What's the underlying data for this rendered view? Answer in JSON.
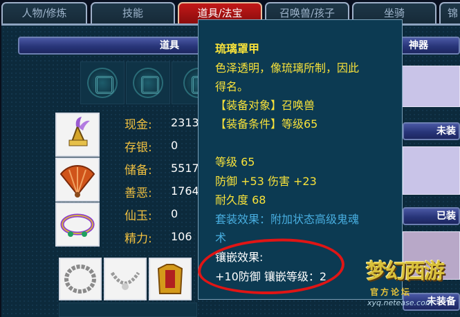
{
  "tabs": [
    {
      "label": "人物/修炼",
      "active": false
    },
    {
      "label": "技能",
      "active": false
    },
    {
      "label": "道具/法宝",
      "active": true
    },
    {
      "label": "召唤兽/孩子",
      "active": false
    },
    {
      "label": "坐骑",
      "active": false
    },
    {
      "label": "锦",
      "active": false
    }
  ],
  "panel": {
    "items_header": "道具",
    "shenqi_header": "神器",
    "side_labels": [
      "未装",
      "已装",
      "未装备"
    ]
  },
  "stats": [
    {
      "label": "现金:",
      "value": "2313"
    },
    {
      "label": "存银:",
      "value": "0"
    },
    {
      "label": "储备:",
      "value": "5517"
    },
    {
      "label": "善恶:",
      "value": "1764"
    },
    {
      "label": "仙玉:",
      "value": "0"
    },
    {
      "label": "精力:",
      "value": "106"
    }
  ],
  "tooltip": {
    "name": "琉璃罩甲",
    "desc_line1": "色泽透明，像琉璃所制，因此",
    "desc_line2": "得名。",
    "target": "【装备对象】召唤兽",
    "requirement": "【装备条件】等级65",
    "level": "等级 65",
    "attributes": "防御 +53 伤害 +23",
    "durability": "耐久度 68",
    "set_effect_line1": "套装效果：附加状态高级鬼魂",
    "set_effect_line2": "术",
    "inlay_title": "镶嵌效果:",
    "inlay_detail": "+10防御 镶嵌等级：2"
  },
  "watermark": {
    "title": "梦幻西游",
    "subtitle": "官方论坛",
    "url": "xyq.netease.com"
  },
  "colors": {
    "active_tab": "#c21818",
    "panel_bg": "#0c2a3c",
    "tooltip_bg": "#0c3a52",
    "highlight_yellow": "#f8e23a",
    "info_blue": "#48aee0",
    "circle_red": "#e01515"
  }
}
